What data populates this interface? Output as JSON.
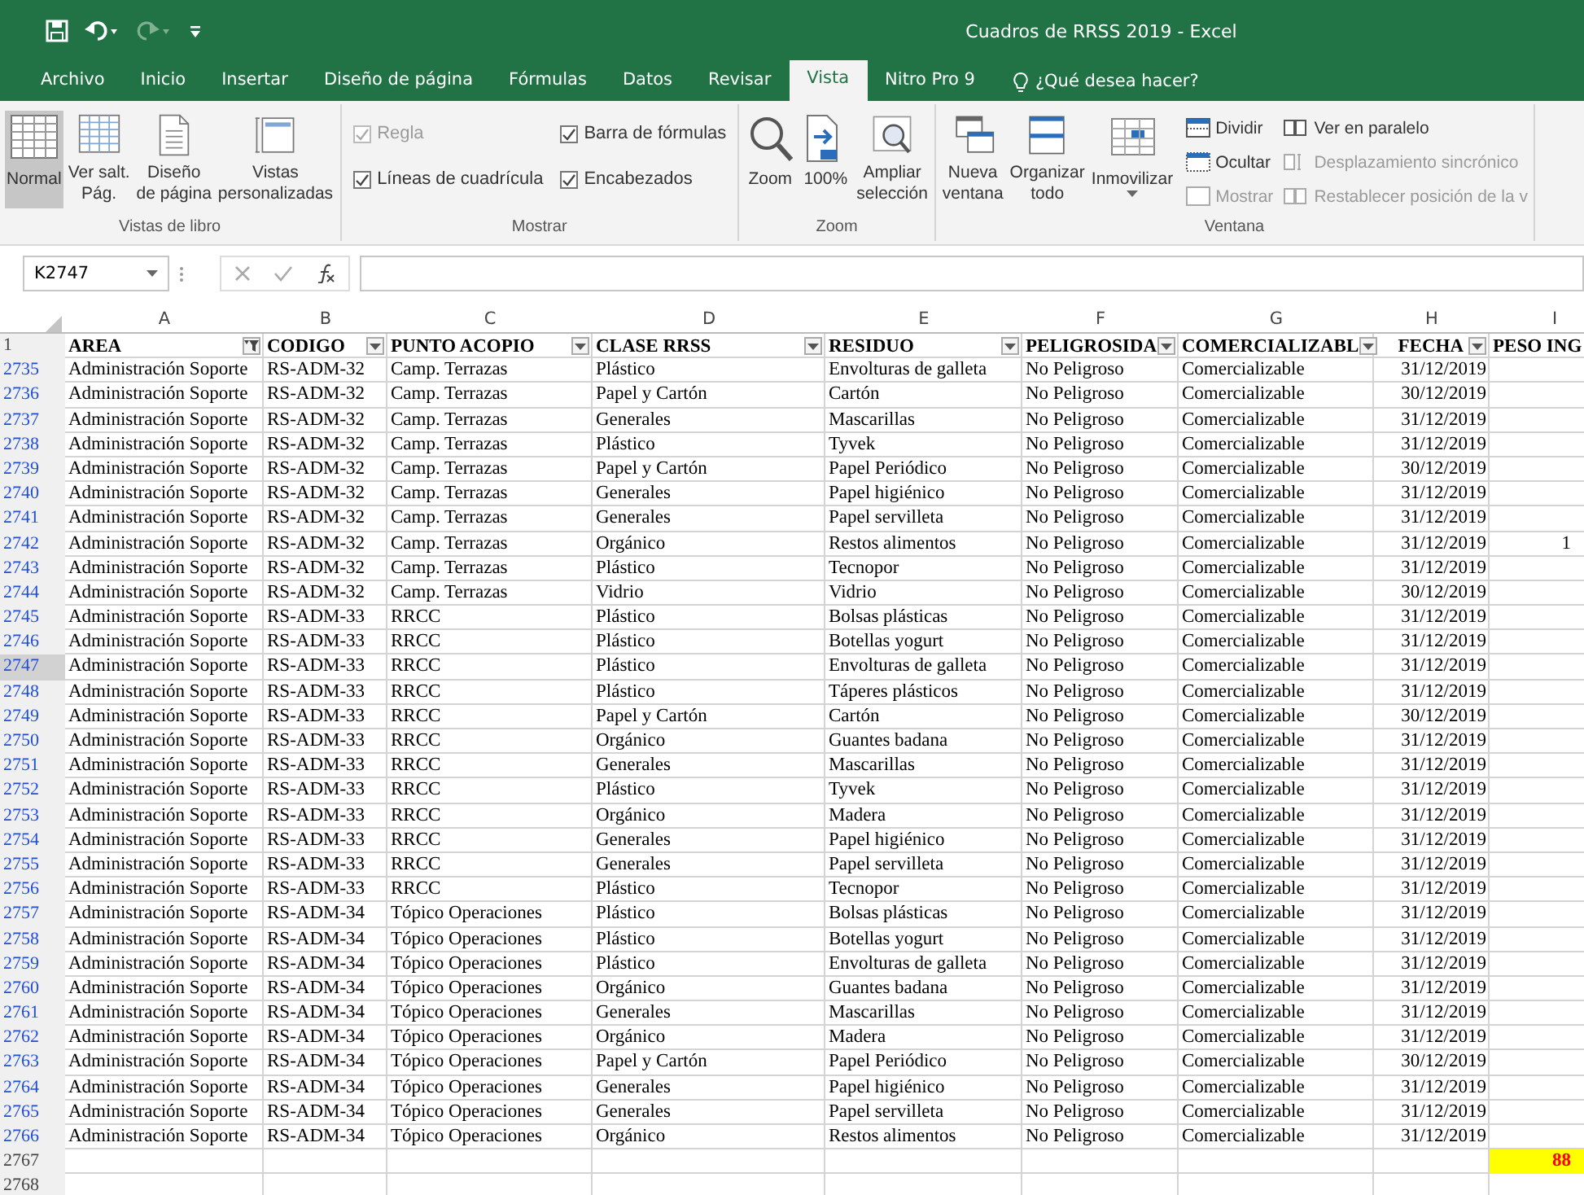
{
  "title_bar": {
    "title": "Cuadros de RRSS 2019 - Excel"
  },
  "tabs": [
    {
      "label": "Archivo",
      "selected": false
    },
    {
      "label": "Inicio",
      "selected": false
    },
    {
      "label": "Insertar",
      "selected": false
    },
    {
      "label": "Diseño de página",
      "selected": false
    },
    {
      "label": "Fórmulas",
      "selected": false
    },
    {
      "label": "Datos",
      "selected": false
    },
    {
      "label": "Revisar",
      "selected": false
    },
    {
      "label": "Vista",
      "selected": true
    },
    {
      "label": "Nitro Pro 9",
      "selected": false
    }
  ],
  "tell_me": "¿Qué desea hacer?",
  "ribbon": {
    "groups": [
      {
        "label": "Vistas de libro",
        "items": [
          {
            "kind": "large",
            "label": "Normal",
            "selected": true
          },
          {
            "kind": "large",
            "label": "Ver salt.\nPág.",
            "selected": false
          },
          {
            "kind": "large",
            "label": "Diseño\nde página",
            "selected": false
          },
          {
            "kind": "large",
            "label": "Vistas\npersonalizadas",
            "selected": false
          }
        ]
      },
      {
        "label": "Mostrar",
        "items": [
          {
            "kind": "checkbox",
            "label": "Regla",
            "checked": true,
            "disabled": true
          },
          {
            "kind": "checkbox",
            "label": "Líneas de cuadrícula",
            "checked": true,
            "disabled": false
          },
          {
            "kind": "checkbox",
            "label": "Barra de fórmulas",
            "checked": true,
            "disabled": false
          },
          {
            "kind": "checkbox",
            "label": "Encabezados",
            "checked": true,
            "disabled": false
          }
        ]
      },
      {
        "label": "Zoom",
        "items": [
          {
            "kind": "large",
            "label": "Zoom"
          },
          {
            "kind": "large",
            "label": "100%"
          },
          {
            "kind": "large",
            "label": "Ampliar\nselección"
          }
        ]
      },
      {
        "label": "Ventana",
        "items": [
          {
            "kind": "large",
            "label": "Nueva\nventana"
          },
          {
            "kind": "large",
            "label": "Organizar\ntodo"
          },
          {
            "kind": "large",
            "label": "Inmovilizar",
            "dropdown": true
          },
          {
            "kind": "small",
            "label": "Dividir",
            "disabled": false
          },
          {
            "kind": "small",
            "label": "Ocultar",
            "disabled": false
          },
          {
            "kind": "small",
            "label": "Mostrar",
            "disabled": true
          },
          {
            "kind": "small",
            "label": "Ver en paralelo",
            "disabled": false
          },
          {
            "kind": "small",
            "label": "Desplazamiento sincrónico",
            "disabled": true
          },
          {
            "kind": "small",
            "label": "Restablecer posición de la v",
            "disabled": true
          }
        ]
      }
    ]
  },
  "formula_bar": {
    "name_box": "K2747"
  },
  "sheet": {
    "columns": [
      {
        "letter": "A",
        "heading": "AREA",
        "filter_active": true
      },
      {
        "letter": "B",
        "heading": "CODIGO",
        "filter_active": false
      },
      {
        "letter": "C",
        "heading": "PUNTO ACOPIO",
        "filter_active": false
      },
      {
        "letter": "D",
        "heading": "CLASE RRSS",
        "filter_active": false
      },
      {
        "letter": "E",
        "heading": "RESIDUO",
        "filter_active": false
      },
      {
        "letter": "F",
        "heading": "PELIGROSIDA",
        "filter_active": false
      },
      {
        "letter": "G",
        "heading": "COMERCIALIZABL",
        "filter_active": false
      },
      {
        "letter": "H",
        "heading": "FECHA",
        "filter_active": false
      },
      {
        "letter": "I",
        "heading": "PESO ING"
      }
    ],
    "header_row": "1",
    "rows": [
      {
        "row": "2735",
        "filtered": true,
        "selected": false,
        "cells": [
          "Administración Soporte",
          "RS-ADM-32",
          "Camp. Terrazas",
          "Plástico",
          "Envolturas de galleta",
          "No Peligroso",
          "Comercializable",
          "31/12/2019"
        ]
      },
      {
        "row": "2736",
        "filtered": true,
        "selected": false,
        "cells": [
          "Administración Soporte",
          "RS-ADM-32",
          "Camp. Terrazas",
          "Papel y Cartón",
          "Cartón",
          "No Peligroso",
          "Comercializable",
          "30/12/2019"
        ]
      },
      {
        "row": "2737",
        "filtered": true,
        "selected": false,
        "cells": [
          "Administración Soporte",
          "RS-ADM-32",
          "Camp. Terrazas",
          "Generales",
          "Mascarillas",
          "No Peligroso",
          "Comercializable",
          "31/12/2019"
        ]
      },
      {
        "row": "2738",
        "filtered": true,
        "selected": false,
        "cells": [
          "Administración Soporte",
          "RS-ADM-32",
          "Camp. Terrazas",
          "Plástico",
          "Tyvek",
          "No Peligroso",
          "Comercializable",
          "31/12/2019"
        ]
      },
      {
        "row": "2739",
        "filtered": true,
        "selected": false,
        "cells": [
          "Administración Soporte",
          "RS-ADM-32",
          "Camp. Terrazas",
          "Papel y Cartón",
          "Papel Periódico",
          "No Peligroso",
          "Comercializable",
          "30/12/2019"
        ]
      },
      {
        "row": "2740",
        "filtered": true,
        "selected": false,
        "cells": [
          "Administración Soporte",
          "RS-ADM-32",
          "Camp. Terrazas",
          "Generales",
          "Papel higiénico",
          "No Peligroso",
          "Comercializable",
          "31/12/2019"
        ]
      },
      {
        "row": "2741",
        "filtered": true,
        "selected": false,
        "cells": [
          "Administración Soporte",
          "RS-ADM-32",
          "Camp. Terrazas",
          "Generales",
          "Papel servilleta",
          "No Peligroso",
          "Comercializable",
          "31/12/2019"
        ]
      },
      {
        "row": "2742",
        "filtered": true,
        "selected": false,
        "cells": [
          "Administración Soporte",
          "RS-ADM-32",
          "Camp. Terrazas",
          "Orgánico",
          "Restos alimentos",
          "No Peligroso",
          "Comercializable",
          "31/12/2019",
          "1"
        ]
      },
      {
        "row": "2743",
        "filtered": true,
        "selected": false,
        "cells": [
          "Administración Soporte",
          "RS-ADM-32",
          "Camp. Terrazas",
          "Plástico",
          "Tecnopor",
          "No Peligroso",
          "Comercializable",
          "31/12/2019"
        ]
      },
      {
        "row": "2744",
        "filtered": true,
        "selected": false,
        "cells": [
          "Administración Soporte",
          "RS-ADM-32",
          "Camp. Terrazas",
          "Vidrio",
          "Vidrio",
          "No Peligroso",
          "Comercializable",
          "30/12/2019"
        ]
      },
      {
        "row": "2745",
        "filtered": true,
        "selected": false,
        "cells": [
          "Administración Soporte",
          "RS-ADM-33",
          "RRCC",
          "Plástico",
          "Bolsas plásticas",
          "No Peligroso",
          "Comercializable",
          "31/12/2019"
        ]
      },
      {
        "row": "2746",
        "filtered": true,
        "selected": false,
        "cells": [
          "Administración Soporte",
          "RS-ADM-33",
          "RRCC",
          "Plástico",
          "Botellas yogurt",
          "No Peligroso",
          "Comercializable",
          "31/12/2019"
        ]
      },
      {
        "row": "2747",
        "filtered": true,
        "selected": true,
        "cells": [
          "Administración Soporte",
          "RS-ADM-33",
          "RRCC",
          "Plástico",
          "Envolturas de galleta",
          "No Peligroso",
          "Comercializable",
          "31/12/2019"
        ]
      },
      {
        "row": "2748",
        "filtered": true,
        "selected": false,
        "cells": [
          "Administración Soporte",
          "RS-ADM-33",
          "RRCC",
          "Plástico",
          "Táperes plásticos",
          "No Peligroso",
          "Comercializable",
          "31/12/2019"
        ]
      },
      {
        "row": "2749",
        "filtered": true,
        "selected": false,
        "cells": [
          "Administración Soporte",
          "RS-ADM-33",
          "RRCC",
          "Papel y Cartón",
          "Cartón",
          "No Peligroso",
          "Comercializable",
          "30/12/2019"
        ]
      },
      {
        "row": "2750",
        "filtered": true,
        "selected": false,
        "cells": [
          "Administración Soporte",
          "RS-ADM-33",
          "RRCC",
          "Orgánico",
          "Guantes badana",
          "No Peligroso",
          "Comercializable",
          "31/12/2019"
        ]
      },
      {
        "row": "2751",
        "filtered": true,
        "selected": false,
        "cells": [
          "Administración Soporte",
          "RS-ADM-33",
          "RRCC",
          "Generales",
          "Mascarillas",
          "No Peligroso",
          "Comercializable",
          "31/12/2019"
        ]
      },
      {
        "row": "2752",
        "filtered": true,
        "selected": false,
        "cells": [
          "Administración Soporte",
          "RS-ADM-33",
          "RRCC",
          "Plástico",
          "Tyvek",
          "No Peligroso",
          "Comercializable",
          "31/12/2019"
        ]
      },
      {
        "row": "2753",
        "filtered": true,
        "selected": false,
        "cells": [
          "Administración Soporte",
          "RS-ADM-33",
          "RRCC",
          "Orgánico",
          "Madera",
          "No Peligroso",
          "Comercializable",
          "31/12/2019"
        ]
      },
      {
        "row": "2754",
        "filtered": true,
        "selected": false,
        "cells": [
          "Administración Soporte",
          "RS-ADM-33",
          "RRCC",
          "Generales",
          "Papel higiénico",
          "No Peligroso",
          "Comercializable",
          "31/12/2019"
        ]
      },
      {
        "row": "2755",
        "filtered": true,
        "selected": false,
        "cells": [
          "Administración Soporte",
          "RS-ADM-33",
          "RRCC",
          "Generales",
          "Papel servilleta",
          "No Peligroso",
          "Comercializable",
          "31/12/2019"
        ]
      },
      {
        "row": "2756",
        "filtered": true,
        "selected": false,
        "cells": [
          "Administración Soporte",
          "RS-ADM-33",
          "RRCC",
          "Plástico",
          "Tecnopor",
          "No Peligroso",
          "Comercializable",
          "31/12/2019"
        ]
      },
      {
        "row": "2757",
        "filtered": true,
        "selected": false,
        "cells": [
          "Administración Soporte",
          "RS-ADM-34",
          "Tópico Operaciones",
          "Plástico",
          "Bolsas plásticas",
          "No Peligroso",
          "Comercializable",
          "31/12/2019"
        ]
      },
      {
        "row": "2758",
        "filtered": true,
        "selected": false,
        "cells": [
          "Administración Soporte",
          "RS-ADM-34",
          "Tópico Operaciones",
          "Plástico",
          "Botellas yogurt",
          "No Peligroso",
          "Comercializable",
          "31/12/2019"
        ]
      },
      {
        "row": "2759",
        "filtered": true,
        "selected": false,
        "cells": [
          "Administración Soporte",
          "RS-ADM-34",
          "Tópico Operaciones",
          "Plástico",
          "Envolturas de galleta",
          "No Peligroso",
          "Comercializable",
          "31/12/2019"
        ]
      },
      {
        "row": "2760",
        "filtered": true,
        "selected": false,
        "cells": [
          "Administración Soporte",
          "RS-ADM-34",
          "Tópico Operaciones",
          "Orgánico",
          "Guantes badana",
          "No Peligroso",
          "Comercializable",
          "31/12/2019"
        ]
      },
      {
        "row": "2761",
        "filtered": true,
        "selected": false,
        "cells": [
          "Administración Soporte",
          "RS-ADM-34",
          "Tópico Operaciones",
          "Generales",
          "Mascarillas",
          "No Peligroso",
          "Comercializable",
          "31/12/2019"
        ]
      },
      {
        "row": "2762",
        "filtered": true,
        "selected": false,
        "cells": [
          "Administración Soporte",
          "RS-ADM-34",
          "Tópico Operaciones",
          "Orgánico",
          "Madera",
          "No Peligroso",
          "Comercializable",
          "31/12/2019"
        ]
      },
      {
        "row": "2763",
        "filtered": true,
        "selected": false,
        "cells": [
          "Administración Soporte",
          "RS-ADM-34",
          "Tópico Operaciones",
          "Papel y Cartón",
          "Papel Periódico",
          "No Peligroso",
          "Comercializable",
          "30/12/2019"
        ]
      },
      {
        "row": "2764",
        "filtered": true,
        "selected": false,
        "cells": [
          "Administración Soporte",
          "RS-ADM-34",
          "Tópico Operaciones",
          "Generales",
          "Papel higiénico",
          "No Peligroso",
          "Comercializable",
          "31/12/2019"
        ]
      },
      {
        "row": "2765",
        "filtered": true,
        "selected": false,
        "cells": [
          "Administración Soporte",
          "RS-ADM-34",
          "Tópico Operaciones",
          "Generales",
          "Papel servilleta",
          "No Peligroso",
          "Comercializable",
          "31/12/2019"
        ]
      },
      {
        "row": "2766",
        "filtered": true,
        "selected": false,
        "cells": [
          "Administración Soporte",
          "RS-ADM-34",
          "Tópico Operaciones",
          "Orgánico",
          "Restos alimentos",
          "No Peligroso",
          "Comercializable",
          "31/12/2019"
        ]
      },
      {
        "row": "2767",
        "filtered": false,
        "selected": false,
        "cells": [],
        "total": {
          "text": "88",
          "color": "#ffff00"
        }
      },
      {
        "row": "2768",
        "filtered": false,
        "selected": false,
        "cells": []
      }
    ]
  }
}
